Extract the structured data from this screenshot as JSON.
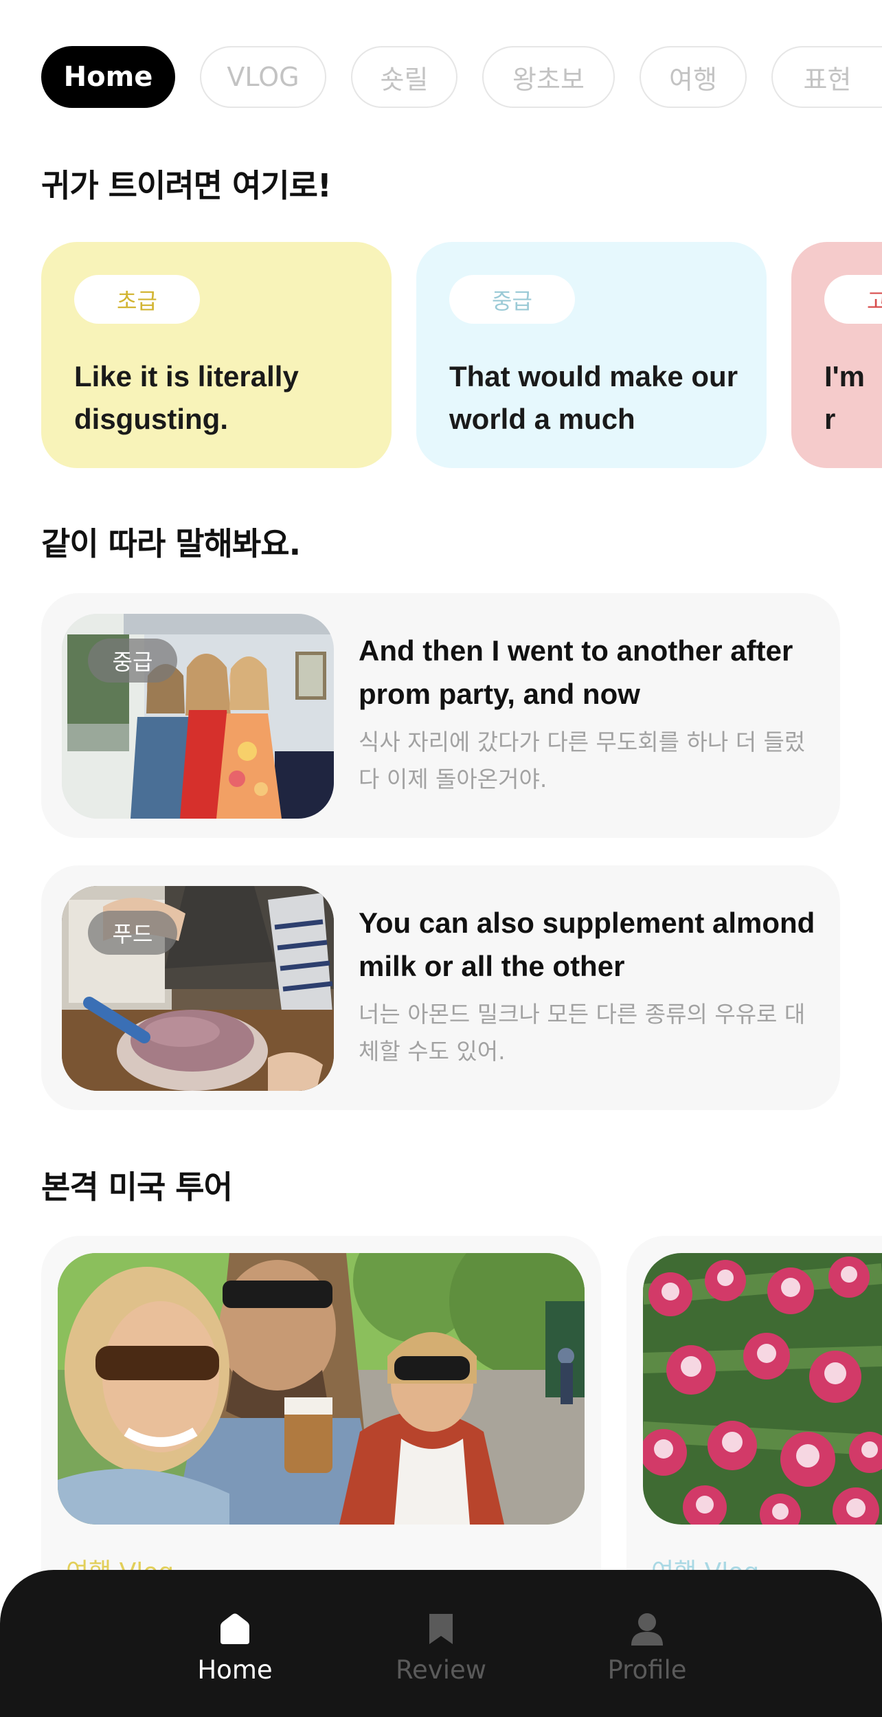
{
  "tabs": [
    {
      "label": "Home",
      "active": true
    },
    {
      "label": "VLOG",
      "active": false
    },
    {
      "label": "숏릴",
      "active": false
    },
    {
      "label": "왕초보",
      "active": false
    },
    {
      "label": "여행",
      "active": false
    },
    {
      "label": "표현",
      "active": false
    }
  ],
  "section_listening": {
    "title": "귀가 트이려면 여기로!",
    "cards": [
      {
        "level": "초급",
        "text": "Like it is literally disgusting.",
        "bg": "#f8f3b9",
        "level_color": "#d2b432"
      },
      {
        "level": "중급",
        "text": "That would make our world a much",
        "bg": "#e6f8fd",
        "level_color": "#9bcad6"
      },
      {
        "level": "고",
        "text": "I'm r abo",
        "bg": "#f5cbcb",
        "level_color": "#d84d4d"
      }
    ]
  },
  "section_shadowing": {
    "title": "같이 따라 말해봐요.",
    "items": [
      {
        "badge": "중급",
        "english": "And then I went to another after prom party, and now",
        "korean": "식사 자리에 갔다가 다른 무도회를 하나 더 들렀다 이제 돌아온거야."
      },
      {
        "badge": "푸드",
        "english": "You can also supplement almond milk or all the other",
        "korean": "너는 아몬드 밀크나 모든 다른 종류의 우유로 대체할 수도 있어."
      }
    ]
  },
  "section_tour": {
    "title": "본격 미국 투어",
    "cards": [
      {
        "category": "여행 Vlog"
      },
      {
        "category": "여행 Vlog"
      }
    ]
  },
  "bottom_nav": [
    {
      "label": "Home",
      "icon": "home-icon",
      "active": true
    },
    {
      "label": "Review",
      "icon": "bookmark-icon",
      "active": false
    },
    {
      "label": "Profile",
      "icon": "profile-icon",
      "active": false
    }
  ],
  "colors": {
    "tour_category_left": "#e2cf5a",
    "tour_category_right": "#a9d8e4",
    "nav_active": "#ffffff",
    "nav_inactive": "#5a5a5a"
  }
}
